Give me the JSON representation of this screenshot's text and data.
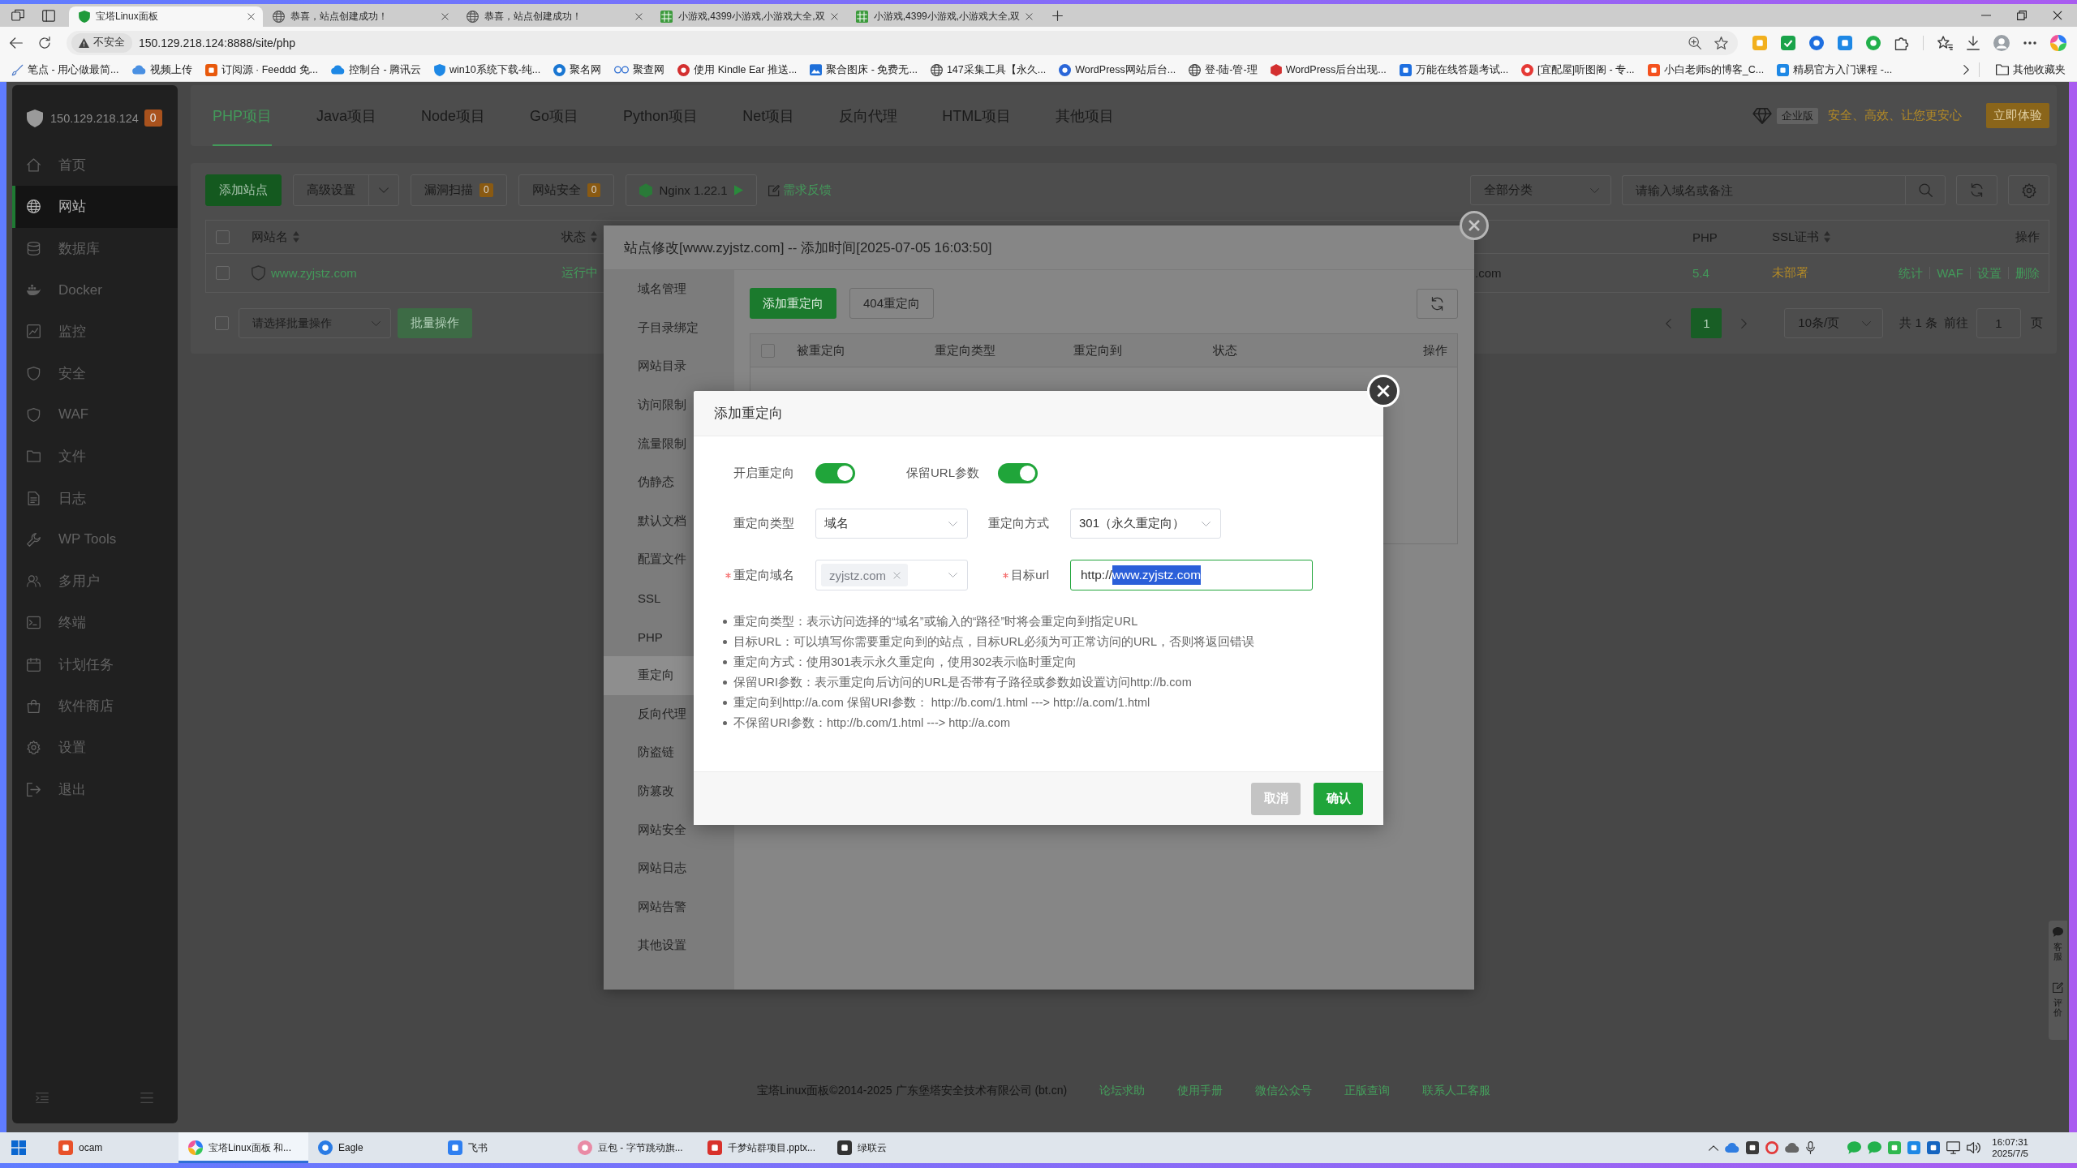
{
  "browser": {
    "tabs": [
      {
        "title": "宝塔Linux面板",
        "selected": true
      },
      {
        "title": "恭喜，站点创建成功！",
        "selected": false
      },
      {
        "title": "恭喜，站点创建成功！",
        "selected": false
      },
      {
        "title": "小游戏,4399小游戏,小游戏大全,双",
        "selected": false
      },
      {
        "title": "小游戏,4399小游戏,小游戏大全,双",
        "selected": false
      }
    ],
    "security_badge": "不安全",
    "url": "150.129.218.124:8888/site/php",
    "bookmarks": [
      "笔点 - 用心做最简...",
      "视频上传",
      "订阅源 · Feeddd 免...",
      "控制台 - 腾讯云",
      "win10系统下载-纯...",
      "聚名网",
      "聚查网",
      "使用 Kindle Ear 推送...",
      "聚合图床 - 免费无...",
      "147采集工具【永久...",
      "WordPress网站后台...",
      "登-陆-管-理",
      "WordPress后台出现...",
      "万能在线答题考试...",
      "[宜配屋]听图阁 - 专...",
      "小白老师s的博客_C...",
      "精易官方入门课程 -..."
    ],
    "other_bookmarks": "其他收藏夹"
  },
  "sidebar": {
    "host": "150.129.218.124",
    "alert_count": "0",
    "items": [
      {
        "label": "首页",
        "selected": false
      },
      {
        "label": "网站",
        "selected": true
      },
      {
        "label": "数据库",
        "selected": false
      },
      {
        "label": "Docker",
        "selected": false
      },
      {
        "label": "监控",
        "selected": false
      },
      {
        "label": "安全",
        "selected": false
      },
      {
        "label": "WAF",
        "selected": false
      },
      {
        "label": "文件",
        "selected": false
      },
      {
        "label": "日志",
        "selected": false
      },
      {
        "label": "WP Tools",
        "selected": false
      },
      {
        "label": "多用户",
        "selected": false
      },
      {
        "label": "终端",
        "selected": false
      },
      {
        "label": "计划任务",
        "selected": false
      },
      {
        "label": "软件商店",
        "selected": false
      },
      {
        "label": "设置",
        "selected": false
      },
      {
        "label": "退出",
        "selected": false
      }
    ]
  },
  "project_tabs": [
    {
      "label": "PHP项目",
      "selected": true
    },
    {
      "label": "Java项目",
      "selected": false
    },
    {
      "label": "Node项目",
      "selected": false
    },
    {
      "label": "Go项目",
      "selected": false
    },
    {
      "label": "Python项目",
      "selected": false
    },
    {
      "label": "Net项目",
      "selected": false
    },
    {
      "label": "反向代理",
      "selected": false
    },
    {
      "label": "HTML项目",
      "selected": false
    },
    {
      "label": "其他项目",
      "selected": false
    }
  ],
  "promo": {
    "edition": "企业版",
    "slogan": "安全、高效、让您更安心",
    "button": "立即体验"
  },
  "toolbar": {
    "add_site": "添加站点",
    "advanced": "高级设置",
    "vuln_scan": {
      "label": "漏洞扫描",
      "count": "0"
    },
    "site_security": {
      "label": "网站安全",
      "count": "0"
    },
    "nginx": "Nginx 1.22.1",
    "feedback": "需求反馈",
    "category": "全部分类",
    "search": {
      "placeholder": "请输入域名或备注"
    }
  },
  "site_table": {
    "all_checked": false,
    "columns": [
      {
        "label": "网站名",
        "sortable": true
      },
      {
        "label": "状态",
        "sortable": true
      },
      {
        "label": "PHP",
        "sortable": false
      },
      {
        "label": "SSL证书",
        "sortable": true
      },
      {
        "label": "操作",
        "sortable": false
      }
    ],
    "rows": [
      {
        "checked": false,
        "name": "www.zyjstz.com",
        "status": "运行中",
        "column_3": ".com",
        "php": "5.4",
        "ssl": "未部署",
        "actions": [
          "统计",
          "WAF",
          "设置",
          "删除"
        ]
      }
    ]
  },
  "batch": {
    "checked": false,
    "placeholder": "请选择批量操作",
    "button": "批量操作"
  },
  "pagination": {
    "pages": [
      {
        "label": "1",
        "selected": true
      }
    ],
    "page_size": "10条/页",
    "total": "共 1 条",
    "goto": "前往",
    "goto_value": "1",
    "unit": "页"
  },
  "footer": {
    "copyright": "宝塔Linux面板©2014-2025 广东堡塔安全技术有限公司 (bt.cn)",
    "links": [
      "论坛求助",
      "使用手册",
      "微信公众号",
      "正版查询",
      "联系人工客服"
    ]
  },
  "side_float": [
    "客服",
    "评价"
  ],
  "site_modal": {
    "title": "站点修改[www.zyjstz.com] -- 添加时间[2025-07-05 16:03:50]",
    "menu": [
      {
        "label": "域名管理",
        "selected": false
      },
      {
        "label": "子目录绑定",
        "selected": false
      },
      {
        "label": "网站目录",
        "selected": false
      },
      {
        "label": "访问限制",
        "selected": false
      },
      {
        "label": "流量限制",
        "selected": false
      },
      {
        "label": "伪静态",
        "selected": false
      },
      {
        "label": "默认文档",
        "selected": false
      },
      {
        "label": "配置文件",
        "selected": false
      },
      {
        "label": "SSL",
        "selected": false
      },
      {
        "label": "PHP",
        "selected": false
      },
      {
        "label": "重定向",
        "selected": true
      },
      {
        "label": "反向代理",
        "selected": false
      },
      {
        "label": "防盗链",
        "selected": false
      },
      {
        "label": "防篡改",
        "selected": false
      },
      {
        "label": "网站安全",
        "selected": false
      },
      {
        "label": "网站日志",
        "selected": false
      },
      {
        "label": "网站告警",
        "selected": false
      },
      {
        "label": "其他设置",
        "selected": false
      }
    ],
    "add_button": "添加重定向",
    "button_404": "404重定向",
    "all_checked": false,
    "columns": [
      "被重定向",
      "重定向类型",
      "重定向到",
      "状态",
      "操作"
    ]
  },
  "redirect_dialog": {
    "title": "添加重定向",
    "toggles": [
      {
        "label": "开启重定向",
        "on": true
      },
      {
        "label": "保留URL参数",
        "on": true
      }
    ],
    "type": {
      "label": "重定向类型",
      "value": "域名"
    },
    "method": {
      "label": "重定向方式",
      "value": "301（永久重定向）"
    },
    "domain": {
      "label": "重定向域名",
      "required": true,
      "tags": [
        "zyjstz.com"
      ]
    },
    "target": {
      "label": "目标url",
      "required": true,
      "value_parts": [
        {
          "text": "http://",
          "selected": false
        },
        {
          "text": "www.zyjstz.com",
          "selected": true
        }
      ]
    },
    "notes": [
      "重定向类型：表示访问选择的“域名”或输入的“路径”时将会重定向到指定URL",
      "目标URL：可以填写你需要重定向到的站点，目标URL必须为可正常访问的URL，否则将返回错误",
      "重定向方式：使用301表示永久重定向，使用302表示临时重定向",
      "保留URI参数：表示重定向后访问的URL是否带有子路径或参数如设置访问http://b.com",
      "重定向到http://a.com 保留URI参数： http://b.com/1.html ---> http://a.com/1.html",
      "不保留URI参数：http://b.com/1.html ---> http://a.com"
    ],
    "buttons": [
      {
        "label": "取消",
        "kind": "cancel"
      },
      {
        "label": "确认",
        "kind": "confirm"
      }
    ]
  },
  "taskbar": {
    "apps": [
      {
        "label": "ocam",
        "selected": false
      },
      {
        "label": "宝塔Linux面板 和...",
        "selected": true
      },
      {
        "label": "Eagle",
        "selected": false
      },
      {
        "label": "飞书",
        "selected": false
      },
      {
        "label": "豆包 - 字节跳动旗...",
        "selected": false
      },
      {
        "label": "千梦站群项目.pptx...",
        "selected": false
      },
      {
        "label": "绿联云",
        "selected": false
      }
    ],
    "time": "16:07:31",
    "date": "2025/7/5"
  }
}
